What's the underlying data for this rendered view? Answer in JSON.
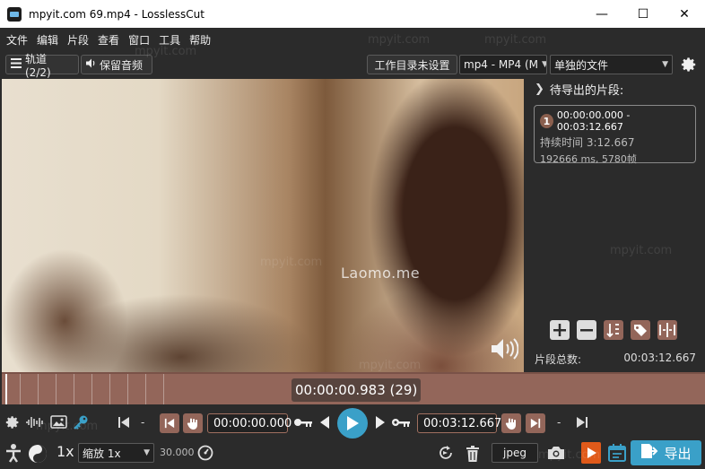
{
  "window": {
    "title": "mpyit.com 69.mp4 - LosslessCut",
    "controls": [
      "—",
      "☐",
      "✕"
    ]
  },
  "menu": [
    "文件",
    "编辑",
    "片段",
    "查看",
    "窗口",
    "工具",
    "帮助"
  ],
  "toolbar": {
    "tracks_label": "轨道 (2/2)",
    "keep_audio_label": "保留音频",
    "workdir_label": "工作目录未设置",
    "format_value": "mp4 - MP4 (M",
    "output_mode_value": "单独的文件"
  },
  "video": {
    "watermark": "Laomo.me"
  },
  "segments_panel": {
    "header": "待导出的片段:",
    "segments": [
      {
        "index": "1",
        "range": "00:00:00.000 - 00:03:12.667",
        "duration": "持续时间 3:12.667",
        "details": "192666 ms, 5780帧"
      }
    ],
    "total_label": "片段总数:",
    "total_value": "00:03:12.667"
  },
  "timeline": {
    "current_time": "00:00:00.983 (29)"
  },
  "controls": {
    "start_time": "00:00:00.000",
    "end_time": "00:03:12.667",
    "dash": "-"
  },
  "bottom": {
    "speed": "1x",
    "zoom_value": "缩放 1x",
    "fps": "30.000",
    "capture_format": "jpeg",
    "export_label": "导出"
  },
  "watermarks": [
    "mpyit.com"
  ],
  "colors": {
    "accent": "#3aa0c8",
    "segment": "#93665a",
    "background": "#2b2b2b"
  }
}
